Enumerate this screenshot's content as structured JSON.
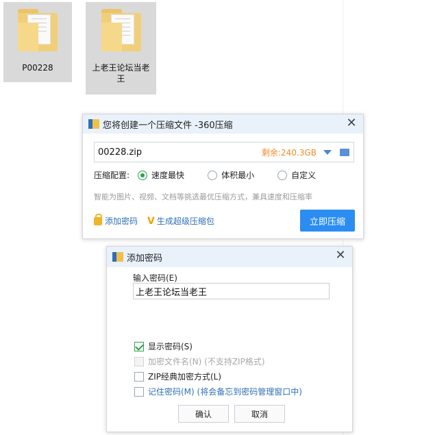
{
  "desktop": {
    "folders": [
      {
        "label": "P00228",
        "icon": "folder-icon"
      },
      {
        "label": "上老王论坛当老王",
        "icon": "folder-icon"
      }
    ]
  },
  "compress_dialog": {
    "title": "您将创建一个压缩文件 -360压缩",
    "close_symbol": "✕",
    "filename": "00228.zip",
    "free_space": "剩余:240.3GB",
    "config_label": "压缩配置:",
    "options": [
      {
        "label": "速度最快",
        "selected": true
      },
      {
        "label": "体积最小",
        "selected": false
      },
      {
        "label": "自定义",
        "selected": false
      }
    ],
    "hint": "智能为图片、视频、文档等挑选最优压缩方式，兼具速度和压缩率",
    "add_password_link": "添加密码",
    "super_package_link": "生成超级压缩包",
    "v_mark": "V",
    "compress_button": "立即压缩"
  },
  "password_dialog": {
    "title": "添加密码",
    "close_symbol": "✕",
    "input_label": "输入密码(E)",
    "password_value": "上老王论坛当老王",
    "checkboxes": [
      {
        "label": "显示密码(S)",
        "checked": true,
        "disabled": false
      },
      {
        "label": "加密文件名(N) (不支持ZIP格式)",
        "checked": false,
        "disabled": true
      },
      {
        "label": "ZIP经典加密方式(L)",
        "checked": false,
        "disabled": false
      },
      {
        "label": "记住密码(M) (将会备忘到密码管理窗口中)",
        "checked": false,
        "disabled": false
      }
    ],
    "ok_button": "确认",
    "cancel_button": "取消"
  },
  "colors": {
    "accent": "#2b8df2",
    "free_space": "#f08a24",
    "radio_selected": "#2aa34b",
    "link": "#2f6fb7"
  }
}
